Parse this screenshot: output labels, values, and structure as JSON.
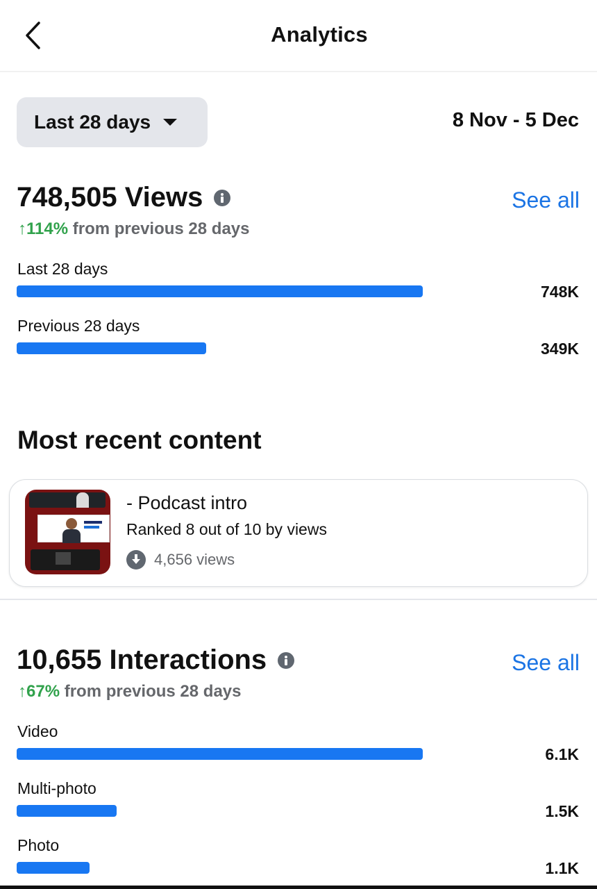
{
  "header": {
    "title": "Analytics",
    "back_icon": "chevron-left-icon"
  },
  "filter": {
    "selected": "Last 28 days",
    "date_range": "8 Nov - 5 Dec"
  },
  "views": {
    "title": "748,505 Views",
    "see_all": "See all",
    "change_pct": "↑114%",
    "change_text": " from previous 28 days",
    "bars": [
      {
        "label": "Last 28 days",
        "value_text": "748K",
        "value": 748
      },
      {
        "label": "Previous 28 days",
        "value_text": "349K",
        "value": 349
      }
    ]
  },
  "recent": {
    "section_title": "Most recent content",
    "item": {
      "title": "- Podcast intro",
      "rank": "Ranked 8 out of 10 by views",
      "views": "4,656 views"
    }
  },
  "interactions": {
    "title": "10,655 Interactions",
    "see_all": "See all",
    "change_pct": "↑67%",
    "change_text": " from previous 28 days",
    "bars": [
      {
        "label": "Video",
        "value_text": "6.1K",
        "value": 6.1
      },
      {
        "label": "Multi-photo",
        "value_text": "1.5K",
        "value": 1.5
      },
      {
        "label": "Photo",
        "value_text": "1.1K",
        "value": 1.1
      }
    ]
  },
  "colors": {
    "bar": "#1877f2",
    "link": "#1b74e4",
    "positive": "#31a24c"
  }
}
